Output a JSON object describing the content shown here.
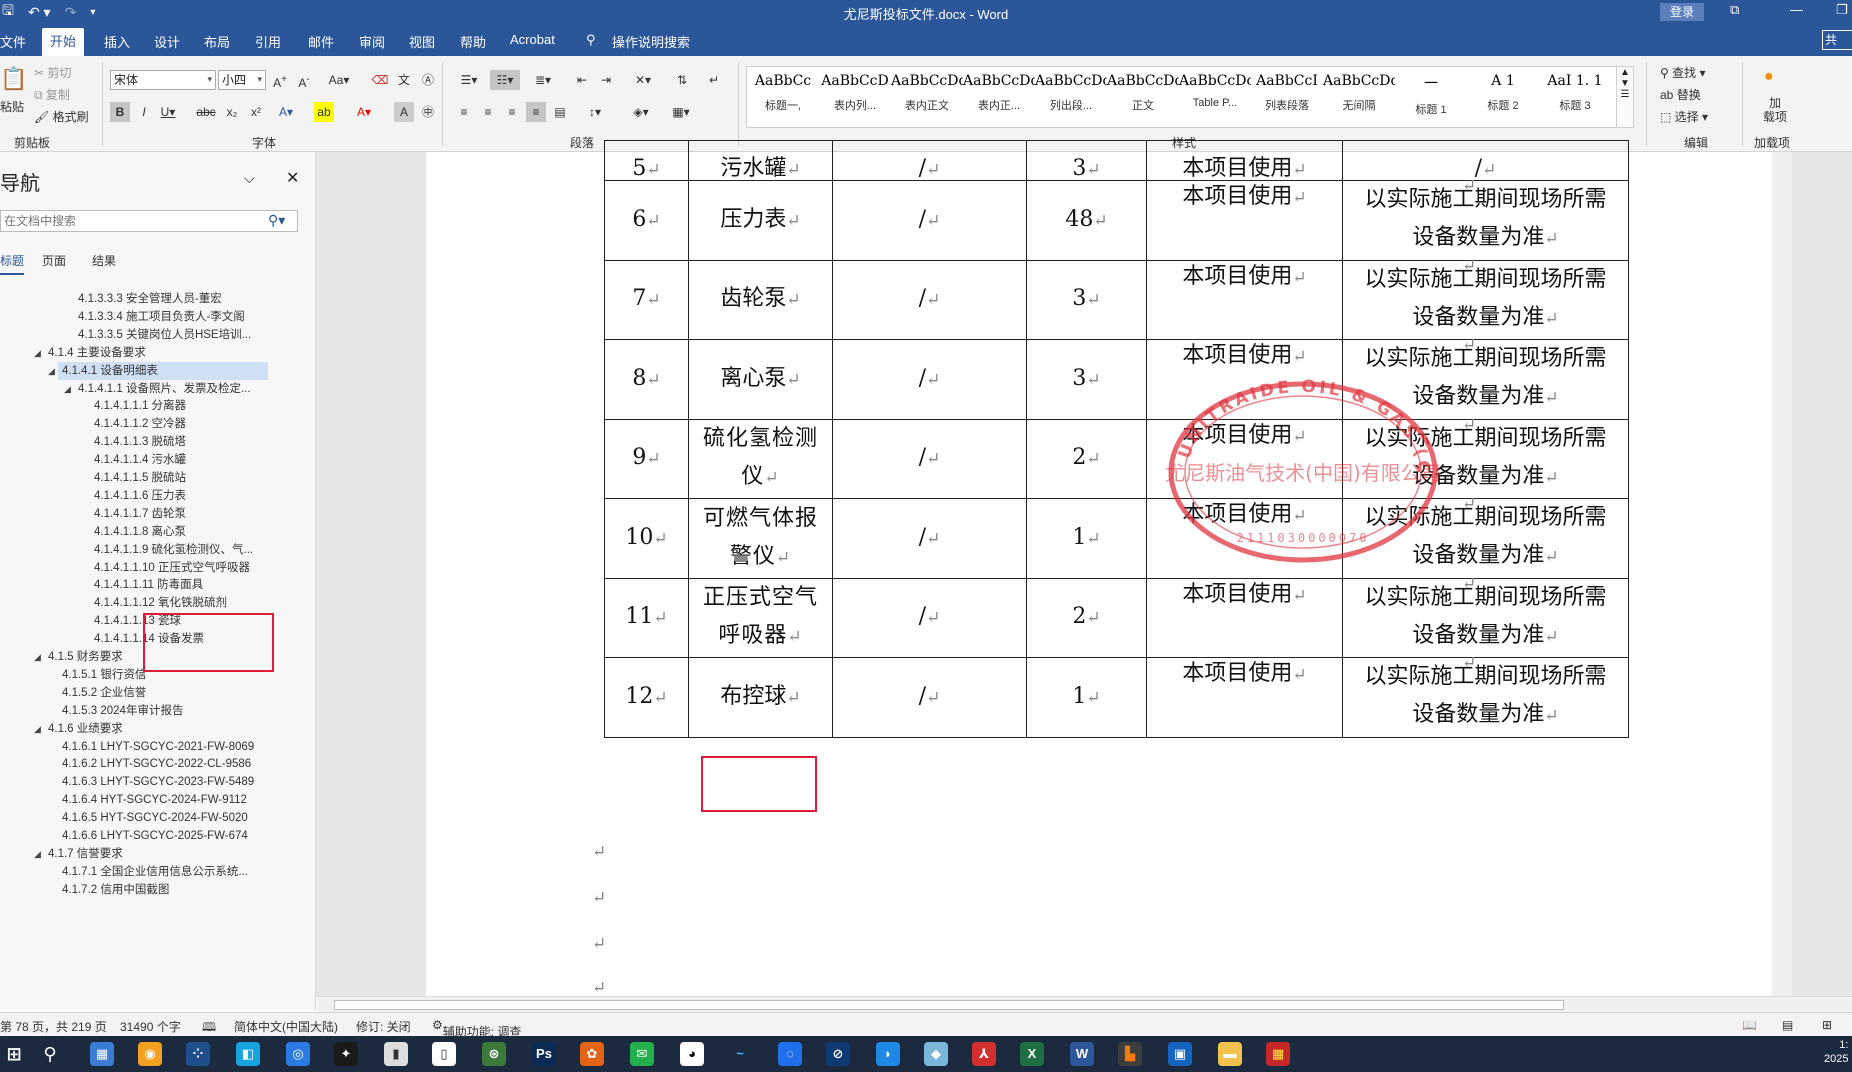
{
  "window": {
    "title": "尤尼斯投标文件.docx - Word",
    "login_label": "登录",
    "share_label": "共"
  },
  "tabs": [
    "文件",
    "开始",
    "插入",
    "设计",
    "布局",
    "引用",
    "邮件",
    "审阅",
    "视图",
    "帮助",
    "Acrobat",
    "操作说明搜索"
  ],
  "ribbon": {
    "clipboard": {
      "paste": "粘贴",
      "cut": "剪切",
      "copy": "复制",
      "format_painter": "格式刷",
      "label": "剪贴板"
    },
    "font": {
      "name": "宋体",
      "size": "小四",
      "label": "字体"
    },
    "paragraph": {
      "label": "段落"
    },
    "styles": {
      "label": "样式",
      "items": [
        {
          "sample": "AaBbCc",
          "name": "标题一,"
        },
        {
          "sample": "AaBbCcD",
          "name": "表内列..."
        },
        {
          "sample": "AaBbCcDdI",
          "name": "表内正文"
        },
        {
          "sample": "AaBbCcDdI",
          "name": "表内正..."
        },
        {
          "sample": "AaBbCcDc",
          "name": "列出段..."
        },
        {
          "sample": "AaBbCcDdI",
          "name": "正文"
        },
        {
          "sample": "AaBbCcDc",
          "name": "Table P..."
        },
        {
          "sample": "AaBbCcI",
          "name": "列表段落"
        },
        {
          "sample": "AaBbCcDdI",
          "name": "无间隔"
        },
        {
          "sample": "一",
          "name": "标题 1"
        },
        {
          "sample": "A 1",
          "name": "标题 2"
        },
        {
          "sample": "AaI 1. 1",
          "name": "标题 3"
        }
      ]
    },
    "editing": {
      "find": "查找",
      "replace": "替换",
      "select": "选择",
      "label": "编辑"
    },
    "addin": {
      "name": "加\n载项",
      "label": "加载项"
    }
  },
  "nav": {
    "title": "导航",
    "search_placeholder": "在文档中搜索",
    "tabs": [
      "标题",
      "页面",
      "结果"
    ],
    "items": [
      {
        "text": "4.1.3.3.3 安全管理人员-董宏",
        "level": 5,
        "arrow": ""
      },
      {
        "text": "4.1.3.3.4 施工项目负责人-李文阁",
        "level": 5,
        "arrow": ""
      },
      {
        "text": "4.1.3.3.5 关键岗位人员HSE培训...",
        "level": 5,
        "arrow": ""
      },
      {
        "text": "4.1.4 主要设备要求",
        "level": 3,
        "arrow": "◢"
      },
      {
        "text": "4.1.4.1 设备明细表",
        "level": 4,
        "arrow": "◢"
      },
      {
        "text": "4.1.4.1.1 设备照片、发票及检定...",
        "level": 5,
        "arrow": "◢"
      },
      {
        "text": "4.1.4.1.1.1 分离器",
        "level": 6,
        "arrow": ""
      },
      {
        "text": "4.1.4.1.1.2 空冷器",
        "level": 6,
        "arrow": ""
      },
      {
        "text": "4.1.4.1.1.3 脱硫塔",
        "level": 6,
        "arrow": ""
      },
      {
        "text": "4.1.4.1.1.4 污水罐",
        "level": 6,
        "arrow": ""
      },
      {
        "text": "4.1.4.1.1.5 脱硫站",
        "level": 6,
        "arrow": ""
      },
      {
        "text": "4.1.4.1.1.6 压力表",
        "level": 6,
        "arrow": ""
      },
      {
        "text": "4.1.4.1.1.7 齿轮泵",
        "level": 6,
        "arrow": ""
      },
      {
        "text": "4.1.4.1.1.8 离心泵",
        "level": 6,
        "arrow": ""
      },
      {
        "text": "4.1.4.1.1.9 硫化氢检测仪、气...",
        "level": 6,
        "arrow": ""
      },
      {
        "text": "4.1.4.1.1.10 正压式空气呼吸器",
        "level": 6,
        "arrow": ""
      },
      {
        "text": "4.1.4.1.1.11 防毒面具",
        "level": 6,
        "arrow": ""
      },
      {
        "text": "4.1.4.1.1.12 氧化铁脱硫剂",
        "level": 6,
        "arrow": ""
      },
      {
        "text": "4.1.4.1.1.13 瓷球",
        "level": 6,
        "arrow": ""
      },
      {
        "text": "4.1.4.1.1.14 设备发票",
        "level": 6,
        "arrow": ""
      },
      {
        "text": "4.1.5 财务要求",
        "level": 3,
        "arrow": "◢"
      },
      {
        "text": "4.1.5.1 银行资信",
        "level": 4,
        "arrow": ""
      },
      {
        "text": "4.1.5.2 企业信誉",
        "level": 4,
        "arrow": ""
      },
      {
        "text": "4.1.5.3 2024年审计报告",
        "level": 4,
        "arrow": ""
      },
      {
        "text": "4.1.6 业绩要求",
        "level": 3,
        "arrow": "◢"
      },
      {
        "text": "4.1.6.1 LHYT-SGCYC-2021-FW-8069",
        "level": 4,
        "arrow": ""
      },
      {
        "text": "4.1.6.2 LHYT-SGCYC-2022-CL-9586",
        "level": 4,
        "arrow": ""
      },
      {
        "text": "4.1.6.3 LHYT-SGCYC-2023-FW-5489",
        "level": 4,
        "arrow": ""
      },
      {
        "text": "4.1.6.4 HYT-SGCYC-2024-FW-9112",
        "level": 4,
        "arrow": ""
      },
      {
        "text": "4.1.6.5 HYT-SGCYC-2024-FW-5020",
        "level": 4,
        "arrow": ""
      },
      {
        "text": "4.1.6.6 LHYT-SGCYC-2025-FW-674",
        "level": 4,
        "arrow": ""
      },
      {
        "text": "4.1.7 信誉要求",
        "level": 3,
        "arrow": "◢"
      },
      {
        "text": "4.1.7.1 全国企业信用信息公示系统...",
        "level": 4,
        "arrow": ""
      },
      {
        "text": "4.1.7.2 信用中国截图",
        "level": 4,
        "arrow": ""
      }
    ],
    "selected_index": 4
  },
  "table": {
    "partial_top": {
      "no": "5",
      "name": "污水罐",
      "spec": "/",
      "qty": "3",
      "use": "本项目使用",
      "note": "/"
    },
    "rows": [
      {
        "no": "6",
        "name": "压力表",
        "spec": "/",
        "qty": "48",
        "use": "本项目使用",
        "note": "以实际施工期间现场所需设备数量为准"
      },
      {
        "no": "7",
        "name": "齿轮泵",
        "spec": "/",
        "qty": "3",
        "use": "本项目使用",
        "note": "以实际施工期间现场所需设备数量为准"
      },
      {
        "no": "8",
        "name": "离心泵",
        "spec": "/",
        "qty": "3",
        "use": "本项目使用",
        "note": "以实际施工期间现场所需设备数量为准"
      },
      {
        "no": "9",
        "name": "硫化氢检测仪",
        "spec": "/",
        "qty": "2",
        "use": "本项目使用",
        "note": "以实际施工期间现场所需设备数量为准"
      },
      {
        "no": "10",
        "name": "可燃气体报警仪",
        "spec": "/",
        "qty": "1",
        "use": "本项目使用",
        "note": "以实际施工期间现场所需设备数量为准"
      },
      {
        "no": "11",
        "name": "正压式空气呼吸器",
        "spec": "/",
        "qty": "2",
        "use": "本项目使用",
        "note": "以实际施工期间现场所需设备数量为准"
      },
      {
        "no": "12",
        "name": "布控球",
        "spec": "/",
        "qty": "1",
        "use": "本项目使用",
        "note": "以实际施工期间现场所需设备数量为准"
      }
    ]
  },
  "stamp": {
    "outer_text": "UNITRAIDE OIL & GAS (CHINA) LLC",
    "inner_text": "尤尼斯油气技术(中国)有限公司",
    "code": "2111030000070",
    "color": "#e0363f"
  },
  "status": {
    "page": "第 78 页，共 219 页",
    "words": "31490 个字",
    "lang": "简体中文(中国大陆)",
    "track": "修订: 关闭",
    "accessibility": "辅助功能: 调查"
  },
  "taskbar": {
    "clock": "1:\n2025"
  },
  "colors": {
    "brand": "#2b579a",
    "highlight_box": "#e31b3a"
  }
}
